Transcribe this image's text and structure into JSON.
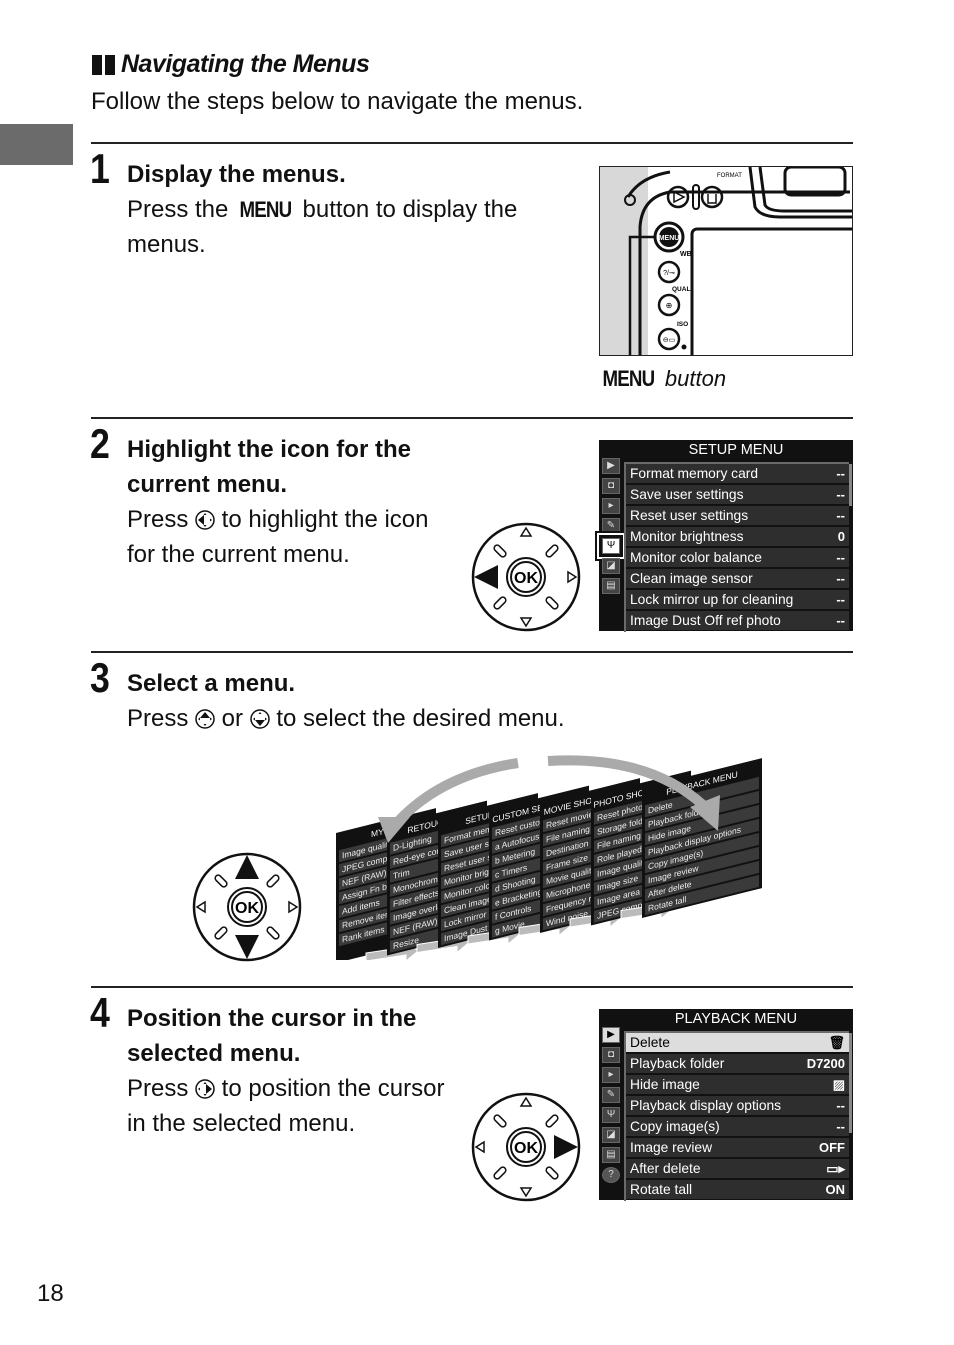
{
  "page": {
    "section_title": "Navigating the Menus",
    "intro": "Follow the steps below to navigate the menus.",
    "page_number": "18"
  },
  "steps": [
    {
      "number": "1",
      "title": "Display the menus.",
      "body_pre": "Press the ",
      "body_keyword": "MENU",
      "body_post": " button to display the menus.",
      "figure_caption_keyword": "MENU",
      "figure_caption": " button",
      "camera_labels": [
        "WB",
        "QUAL",
        "ISO",
        "MENU"
      ]
    },
    {
      "number": "2",
      "title": "Highlight the icon for the current menu.",
      "body_pre": "Press ",
      "body_icon": "multi-selector-left-icon",
      "body_post": " to highlight the icon for the current menu.",
      "pad_ok": "OK",
      "lcd": {
        "title": "SETUP MENU",
        "items": [
          {
            "label": "Format memory card",
            "value": "--"
          },
          {
            "label": "Save user settings",
            "value": "--"
          },
          {
            "label": "Reset user settings",
            "value": "--"
          },
          {
            "label": "Monitor brightness",
            "value": "0"
          },
          {
            "label": "Monitor color balance",
            "value": "--"
          },
          {
            "label": "Clean image sensor",
            "value": "--"
          },
          {
            "label": "Lock mirror up for cleaning",
            "value": "--"
          },
          {
            "label": "Image Dust Off ref photo",
            "value": "--"
          }
        ]
      }
    },
    {
      "number": "3",
      "title": "Select a menu.",
      "body_pre": "Press ",
      "body_icon1": "multi-selector-up-icon",
      "body_mid": " or ",
      "body_icon2": "multi-selector-down-icon",
      "body_post": " to select the desired menu.",
      "pad_ok": "OK",
      "stack_menus": [
        {
          "title": "MY MENU",
          "items": [
            "Image quality",
            "JPEG compression",
            "NEF (RAW) recording",
            "Assign Fn button",
            "Add items",
            "Remove items",
            "Rank items"
          ]
        },
        {
          "title": "RETOUCH MENU",
          "items": [
            "D-Lighting",
            "Red-eye correction",
            "Trim",
            "Monochrome",
            "Filter effects",
            "Image overlay",
            "NEF (RAW) processing",
            "Resize"
          ]
        },
        {
          "title": "SETUP MENU",
          "items": [
            "Format memory card",
            "Save user settings",
            "Reset user settings",
            "Monitor brightness",
            "Monitor color balance",
            "Clean image sensor",
            "Lock mirror up",
            "Image Dust Off"
          ]
        },
        {
          "title": "CUSTOM SETTING MENU",
          "items": [
            "Reset custom settings",
            "a Autofocus",
            "b Metering",
            "c Timers",
            "d Shooting",
            "e Bracketing",
            "f Controls",
            "g Movie"
          ]
        },
        {
          "title": "MOVIE SHOOTING MENU",
          "items": [
            "Reset movie",
            "File naming",
            "Destination",
            "Frame size",
            "Movie quality",
            "Microphone",
            "Frequency response",
            "Wind noise reduction"
          ]
        },
        {
          "title": "PHOTO SHOOTING MENU",
          "items": [
            "Reset photo",
            "Storage folder",
            "File naming",
            "Role played",
            "Image quality",
            "Image size",
            "Image area",
            "JPEG compression"
          ]
        },
        {
          "title": "PLAYBACK MENU",
          "items": [
            "Delete",
            "Playback folder",
            "Hide image",
            "Playback display options",
            "Copy image(s)",
            "Image review",
            "After delete",
            "Rotate tall"
          ]
        }
      ]
    },
    {
      "number": "4",
      "title": "Position the cursor in the selected menu.",
      "body_pre": "Press ",
      "body_icon": "multi-selector-right-icon",
      "body_post": " to position the cursor in the selected menu.",
      "pad_ok": "OK",
      "lcd": {
        "title": "PLAYBACK MENU",
        "items": [
          {
            "label": "Delete",
            "value": "🗑"
          },
          {
            "label": "Playback folder",
            "value": "D7200"
          },
          {
            "label": "Hide image",
            "value": "▨"
          },
          {
            "label": "Playback display options",
            "value": "--"
          },
          {
            "label": "Copy image(s)",
            "value": "--"
          },
          {
            "label": "Image review",
            "value": "OFF"
          },
          {
            "label": "After delete",
            "value": "▭▸"
          },
          {
            "label": "Rotate tall",
            "value": "ON"
          }
        ]
      }
    }
  ]
}
